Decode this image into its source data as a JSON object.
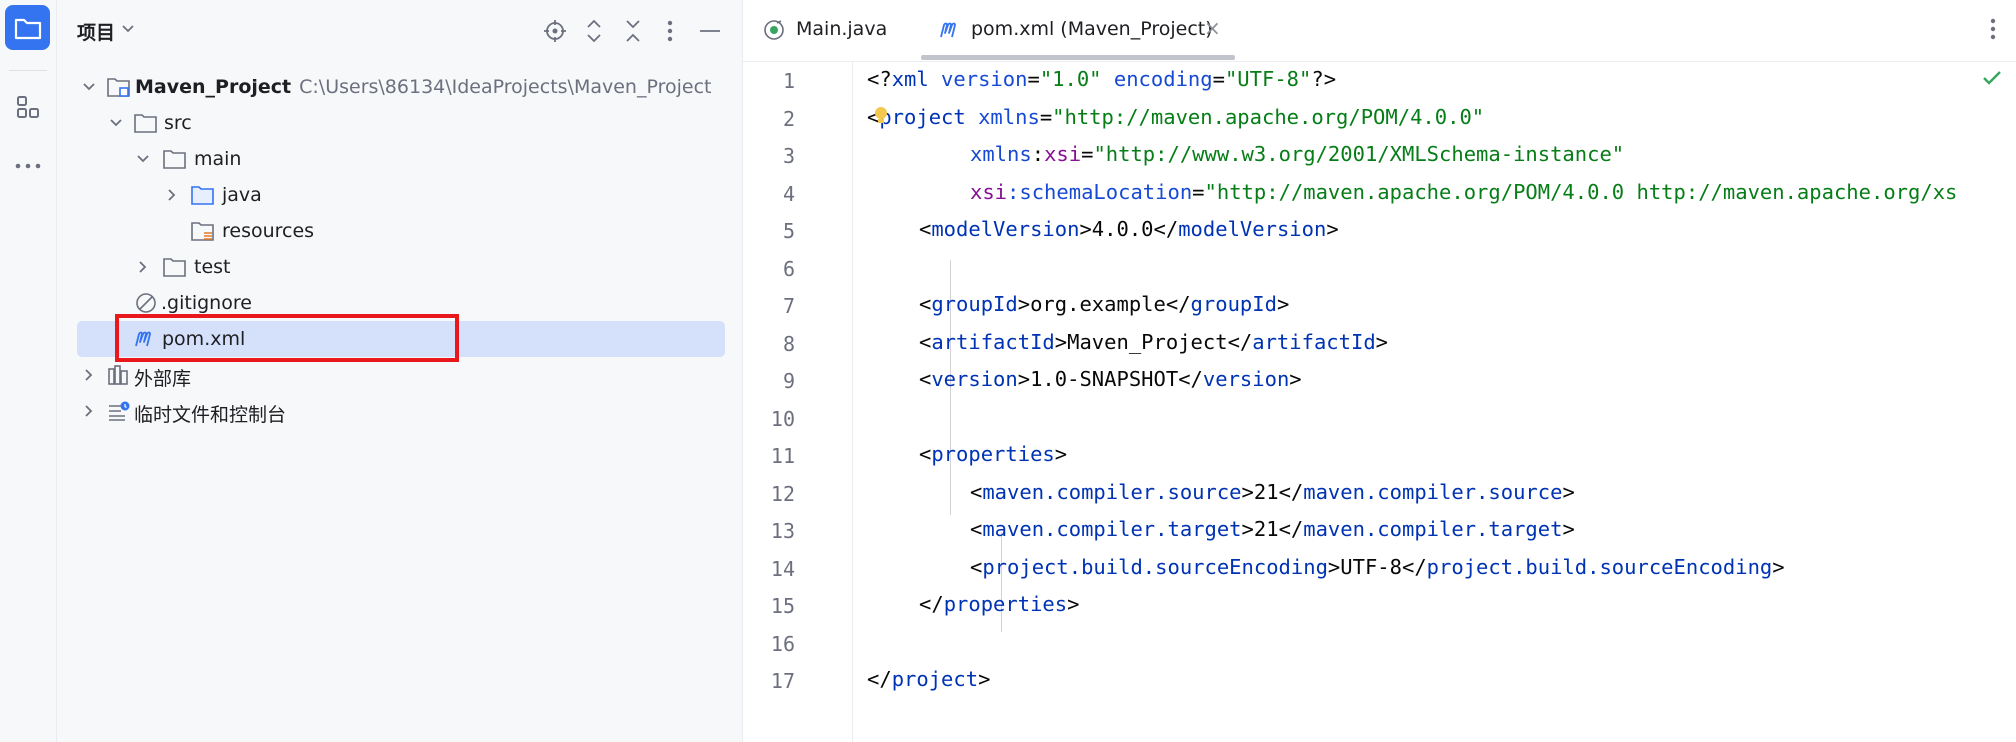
{
  "project_panel": {
    "title": "项目",
    "tree": [
      {
        "name": "Maven_Project",
        "path": "C:\\Users\\86134\\IdeaProjects\\Maven_Project"
      },
      {
        "name": "src"
      },
      {
        "name": "main"
      },
      {
        "name": "java"
      },
      {
        "name": "resources"
      },
      {
        "name": "test"
      },
      {
        "name": ".gitignore"
      },
      {
        "name": "pom.xml"
      },
      {
        "name": "外部库"
      },
      {
        "name": "临时文件和控制台"
      }
    ]
  },
  "editor": {
    "tabs": [
      {
        "label": "Main.java",
        "active": false
      },
      {
        "label": "pom.xml (Maven_Project)",
        "active": true
      }
    ],
    "line_numbers": [
      "1",
      "2",
      "3",
      "4",
      "5",
      "6",
      "7",
      "8",
      "9",
      "10",
      "11",
      "12",
      "13",
      "14",
      "15",
      "16",
      "17"
    ],
    "code": {
      "l1": {
        "a": "<?",
        "b": "xml",
        "c": " version",
        "d": "=",
        "e": "\"1.0\"",
        "f": " encoding",
        "g": "=",
        "h": "\"UTF-8\"",
        "i": "?>"
      },
      "l2": {
        "a": "<",
        "b": "project",
        "c": " xmlns",
        "d": "=",
        "e": "\"http://maven.apache.org/POM/4.0.0\""
      },
      "l3": {
        "a": "xmlns",
        "b": ":",
        "c": "xsi",
        "d": "=",
        "e": "\"http://www.w3.org/2001/XMLSchema-instance\""
      },
      "l4": {
        "a": "xsi",
        "b": ":schemaLocation",
        "c": "=",
        "d": "\"http://maven.apache.org/POM/4.0.0 http://maven.apache.org/xs"
      },
      "l5": {
        "o": "<",
        "t": "modelVersion",
        "c": ">",
        "v": "4.0.0",
        "o2": "</",
        "t2": "modelVersion",
        "c2": ">"
      },
      "l7": {
        "o": "<",
        "t": "groupId",
        "c": ">",
        "v": "org.example",
        "o2": "</",
        "t2": "groupId",
        "c2": ">"
      },
      "l8": {
        "o": "<",
        "t": "artifactId",
        "c": ">",
        "v": "Maven_Project",
        "o2": "</",
        "t2": "artifactId",
        "c2": ">"
      },
      "l9": {
        "o": "<",
        "t": "version",
        "c": ">",
        "v": "1.0-SNAPSHOT",
        "o2": "</",
        "t2": "version",
        "c2": ">"
      },
      "l11": {
        "o": "<",
        "t": "properties",
        "c": ">"
      },
      "l12": {
        "o": "<",
        "t": "maven.compiler.source",
        "c": ">",
        "v": "21",
        "o2": "</",
        "t2": "maven.compiler.source",
        "c2": ">"
      },
      "l13": {
        "o": "<",
        "t": "maven.compiler.target",
        "c": ">",
        "v": "21",
        "o2": "</",
        "t2": "maven.compiler.target",
        "c2": ">"
      },
      "l14": {
        "o": "<",
        "t": "project.build.sourceEncoding",
        "c": ">",
        "v": "UTF-8",
        "o2": "</",
        "t2": "project.build.sourceEncoding",
        "c2": ">"
      },
      "l15": {
        "o": "</",
        "t": "properties",
        "c": ">"
      },
      "l17": {
        "o": "</",
        "t": "project",
        "c": ">"
      }
    }
  },
  "colors": {
    "accent": "#3574f0",
    "selection": "#d5e1fb",
    "highlight": "#e8181c",
    "tag": "#0033b3",
    "string": "#067d17",
    "namespace": "#871094"
  },
  "icons": [
    "folder-icon",
    "structure-icon",
    "more-icon",
    "locate-icon",
    "expand-icon",
    "collapse-icon",
    "kebab-icon",
    "minimize-icon",
    "maven-icon",
    "java-file-icon",
    "ignore-file-icon",
    "library-icon",
    "scratches-icon",
    "check-icon",
    "lightbulb-icon"
  ]
}
